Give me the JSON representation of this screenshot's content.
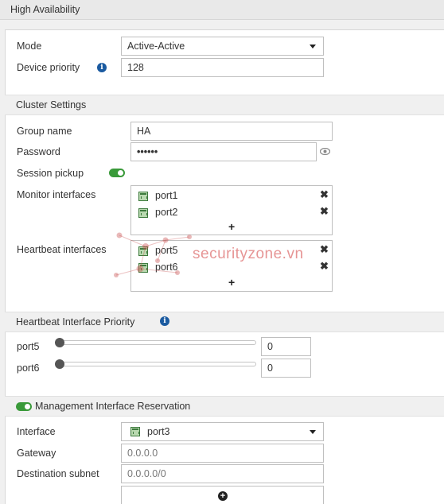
{
  "page_title": "High Availability",
  "mode": {
    "label": "Mode",
    "value": "Active-Active"
  },
  "device_priority": {
    "label": "Device priority",
    "value": "128"
  },
  "cluster": {
    "section_title": "Cluster Settings",
    "group_name": {
      "label": "Group name",
      "value": "HA"
    },
    "password": {
      "label": "Password",
      "value": "••••••"
    },
    "session_pickup": {
      "label": "Session pickup",
      "enabled": true
    },
    "monitor_interfaces": {
      "label": "Monitor interfaces",
      "items": [
        "port1",
        "port2"
      ]
    },
    "heartbeat_interfaces": {
      "label": "Heartbeat interfaces",
      "items": [
        "port5",
        "port6"
      ]
    }
  },
  "heartbeat_priority": {
    "section_title": "Heartbeat Interface Priority",
    "rows": [
      {
        "label": "port5",
        "value": "0"
      },
      {
        "label": "port6",
        "value": "0"
      }
    ]
  },
  "mgmt": {
    "section_title": "Management Interface Reservation",
    "enabled": true,
    "interface": {
      "label": "Interface",
      "value": "port3"
    },
    "gateway": {
      "label": "Gateway",
      "placeholder": "0.0.0.0"
    },
    "destination_subnet": {
      "label": "Destination subnet",
      "placeholder": "0.0.0.0/0"
    }
  },
  "watermark": "securityzone.vn",
  "colors": {
    "toggle_on": "#3a9a3a",
    "info_icon": "#1a5aa0",
    "section_bg": "#f0f0f0"
  }
}
